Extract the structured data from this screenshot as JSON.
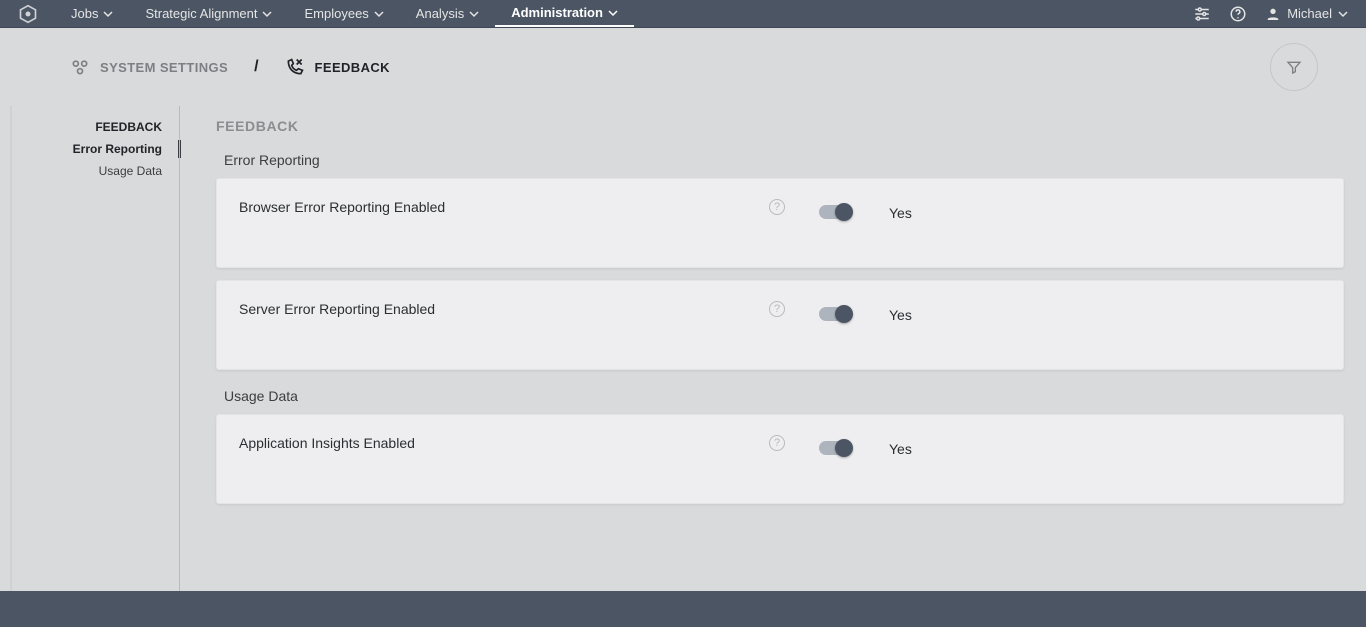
{
  "nav": {
    "items": [
      {
        "label": "Jobs"
      },
      {
        "label": "Strategic Alignment"
      },
      {
        "label": "Employees"
      },
      {
        "label": "Analysis"
      },
      {
        "label": "Administration",
        "active": true
      }
    ]
  },
  "user": {
    "name": "Michael"
  },
  "breadcrumb": {
    "root": "SYSTEM SETTINGS",
    "sep": "/",
    "leaf": "FEEDBACK"
  },
  "sidebar": {
    "heading": "FEEDBACK",
    "items": [
      {
        "label": "Error Reporting",
        "active": true
      },
      {
        "label": "Usage Data"
      }
    ]
  },
  "main": {
    "section_title": "FEEDBACK",
    "groups": [
      {
        "title": "Error Reporting",
        "settings": [
          {
            "label": "Browser Error Reporting Enabled",
            "value_label": "Yes",
            "on": true
          },
          {
            "label": "Server Error Reporting Enabled",
            "value_label": "Yes",
            "on": true
          }
        ]
      },
      {
        "title": "Usage Data",
        "settings": [
          {
            "label": "Application Insights Enabled",
            "value_label": "Yes",
            "on": true
          }
        ]
      }
    ]
  }
}
